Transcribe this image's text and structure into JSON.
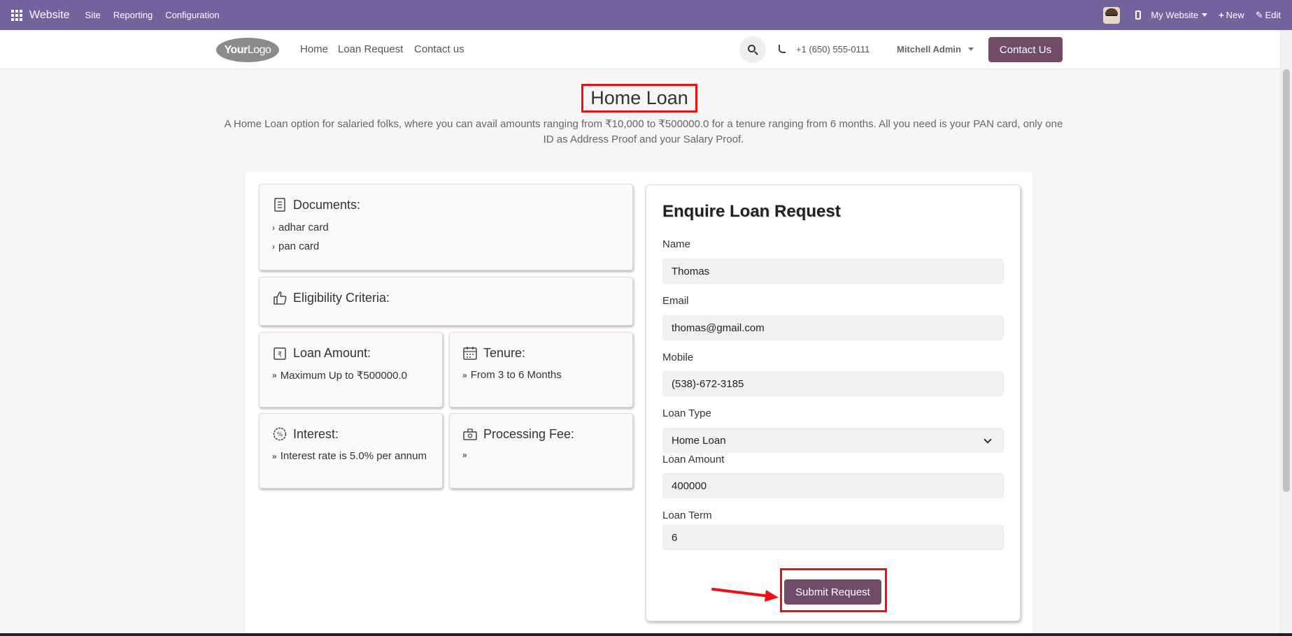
{
  "admin_bar": {
    "brand": "Website",
    "menus": [
      "Site",
      "Reporting",
      "Configuration"
    ],
    "website_selector": "My Website",
    "new_label": "New",
    "edit_label": "Edit"
  },
  "header": {
    "logo_text_bold": "Your",
    "logo_text_light": "Logo",
    "nav": [
      "Home",
      "Loan Request",
      "Contact us"
    ],
    "phone": "+1 (650) 555-0111",
    "user": "Mitchell Admin",
    "contact_button": "Contact Us"
  },
  "page": {
    "title": "Home Loan",
    "description": "A Home Loan option for salaried folks, where you can avail amounts ranging from ₹10,000 to ₹500000.0 for a tenure ranging from 6 months. All you need is your PAN card, only one ID as Address Proof and your Salary Proof."
  },
  "cards": {
    "documents": {
      "title": "Documents:",
      "items": [
        "adhar card",
        "pan card"
      ]
    },
    "eligibility": {
      "title": "Eligibility Criteria:"
    },
    "loan_amount": {
      "title": "Loan Amount:",
      "item": "Maximum Up to ₹500000.0"
    },
    "tenure": {
      "title": "Tenure:",
      "item": "From 3 to 6 Months"
    },
    "interest": {
      "title": "Interest:",
      "item": "Interest rate is 5.0% per annum"
    },
    "processing_fee": {
      "title": "Processing Fee:",
      "item": ""
    }
  },
  "form": {
    "title": "Enquire Loan Request",
    "fields": {
      "name": {
        "label": "Name",
        "value": "Thomas"
      },
      "email": {
        "label": "Email",
        "value": "thomas@gmail.com"
      },
      "mobile": {
        "label": "Mobile",
        "value": "(538)-672-3185"
      },
      "loan_type": {
        "label": "Loan Type",
        "value": "Home Loan"
      },
      "loan_amount": {
        "label": "Loan Amount",
        "value": "400000"
      },
      "loan_term": {
        "label": "Loan Term",
        "value": "6"
      }
    },
    "submit_label": "Submit Request"
  },
  "colors": {
    "admin_bar": "#71639e",
    "brand_button": "#714b67",
    "highlight": "#ee1111"
  }
}
